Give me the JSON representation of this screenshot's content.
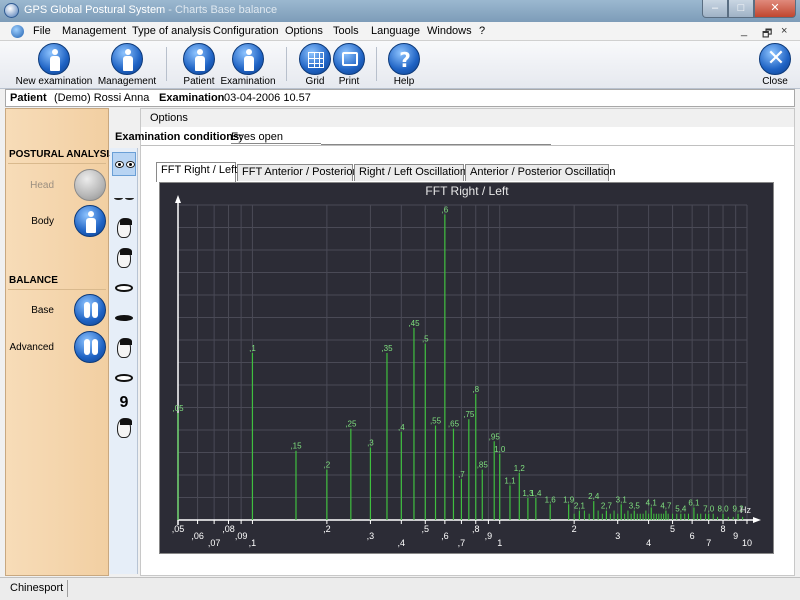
{
  "window": {
    "title": "GPS Global Postural System",
    "subtitle": " - Charts Base balance",
    "minimize_label": "–",
    "maximize_label": "□",
    "close_label": "✕"
  },
  "menu": {
    "items": [
      "File",
      "Management",
      "Type of analysis",
      "Configuration",
      "Options",
      "Tools",
      "Language",
      "Windows",
      "?"
    ],
    "mdi_minimize": "_",
    "mdi_restore": "🗗",
    "mdi_close": "×"
  },
  "toolbar": {
    "new_examination": "New examination",
    "management": "Management",
    "patient": "Patient",
    "examination": "Examination",
    "grid": "Grid",
    "print": "Print",
    "help": "Help",
    "close": "Close"
  },
  "infobar": {
    "patient_label": "Patient",
    "patient_value": "(Demo) Rossi Anna",
    "exam_label": "Examination",
    "exam_value": "03-04-2006 10.57"
  },
  "leftpanel": {
    "postural_title": "POSTURAL ANALYSIS",
    "head": "Head",
    "body": "Body",
    "balance_title": "BALANCE",
    "base": "Base",
    "advanced": "Advanced"
  },
  "iconstrip": {
    "icons": [
      "eyes-open-icon",
      "eyes-closed-icon",
      "head-turned-icon",
      "head-front-icon",
      "mouth-open-icon",
      "teeth-clenched-icon",
      "head-profile-icon",
      "mouth-wide-icon",
      "number-nine-icon",
      "foam-pad-icon"
    ],
    "nine_text": "9"
  },
  "main": {
    "options_label": "Options",
    "conditions_label": "Examination conditions:",
    "conditions_value": "Eyes open",
    "tabs": [
      "FFT Right / Left",
      "FFT Anterior / Posterior",
      "Right / Left Oscillation",
      "Anterior / Posterior Oscillation"
    ],
    "active_tab": 0
  },
  "chart_data": {
    "type": "bar",
    "title": "FFT Right / Left",
    "xlabel": "Hz",
    "ylabel": "",
    "x_scale": "log",
    "xlim": [
      0.05,
      10
    ],
    "ylim": [
      0,
      1
    ],
    "background": "#2c2c36",
    "bar_color": "#3fbf3f",
    "label_color": "#7fe07f",
    "grid": true,
    "x_ticks": [
      {
        "v": 0.05,
        "t": ",05"
      },
      {
        "v": 0.06,
        "t": ",06"
      },
      {
        "v": 0.07,
        "t": ",07"
      },
      {
        "v": 0.08,
        "t": ",08"
      },
      {
        "v": 0.09,
        "t": ",09"
      },
      {
        "v": 0.1,
        "t": ",1"
      },
      {
        "v": 0.2,
        "t": ",2"
      },
      {
        "v": 0.3,
        "t": ",3"
      },
      {
        "v": 0.4,
        "t": ",4"
      },
      {
        "v": 0.5,
        "t": ",5"
      },
      {
        "v": 0.6,
        "t": ",6"
      },
      {
        "v": 0.7,
        "t": ",7"
      },
      {
        "v": 0.8,
        "t": ",8"
      },
      {
        "v": 0.9,
        "t": ",9"
      },
      {
        "v": 1,
        "t": "1"
      },
      {
        "v": 2,
        "t": "2"
      },
      {
        "v": 3,
        "t": "3"
      },
      {
        "v": 4,
        "t": "4"
      },
      {
        "v": 5,
        "t": "5"
      },
      {
        "v": 6,
        "t": "6"
      },
      {
        "v": 7,
        "t": "7"
      },
      {
        "v": 8,
        "t": "8"
      },
      {
        "v": 9,
        "t": "9"
      },
      {
        "v": 10,
        "t": "10"
      }
    ],
    "bars": [
      {
        "x": 0.05,
        "y": 0.34,
        "label": ",05"
      },
      {
        "x": 0.1,
        "y": 0.53,
        "label": ",1"
      },
      {
        "x": 0.15,
        "y": 0.22,
        "label": ",15"
      },
      {
        "x": 0.2,
        "y": 0.16,
        "label": ",2"
      },
      {
        "x": 0.25,
        "y": 0.29,
        "label": ",25"
      },
      {
        "x": 0.3,
        "y": 0.23,
        "label": ",3"
      },
      {
        "x": 0.35,
        "y": 0.53,
        "label": ",35"
      },
      {
        "x": 0.4,
        "y": 0.28,
        "label": ",4"
      },
      {
        "x": 0.45,
        "y": 0.61,
        "label": ",45"
      },
      {
        "x": 0.5,
        "y": 0.56,
        "label": ",5"
      },
      {
        "x": 0.55,
        "y": 0.3,
        "label": ",55"
      },
      {
        "x": 0.6,
        "y": 0.97,
        "label": ",6"
      },
      {
        "x": 0.65,
        "y": 0.29,
        "label": ",65"
      },
      {
        "x": 0.7,
        "y": 0.13,
        "label": ",7"
      },
      {
        "x": 0.75,
        "y": 0.32,
        "label": ",75"
      },
      {
        "x": 0.8,
        "y": 0.4,
        "label": ",8"
      },
      {
        "x": 0.85,
        "y": 0.16,
        "label": ",85"
      },
      {
        "x": 0.95,
        "y": 0.25,
        "label": ",95"
      },
      {
        "x": 1.0,
        "y": 0.21,
        "label": "1,0"
      },
      {
        "x": 1.1,
        "y": 0.11,
        "label": "1,1"
      },
      {
        "x": 1.2,
        "y": 0.15,
        "label": "1,2"
      },
      {
        "x": 1.3,
        "y": 0.07,
        "label": "1,3"
      },
      {
        "x": 1.4,
        "y": 0.07,
        "label": "1,4"
      },
      {
        "x": 1.6,
        "y": 0.05,
        "label": "1,6"
      },
      {
        "x": 1.9,
        "y": 0.05,
        "label": "1,9"
      },
      {
        "x": 2.1,
        "y": 0.03,
        "label": "2,1"
      },
      {
        "x": 2.4,
        "y": 0.06,
        "label": "2,4"
      },
      {
        "x": 2.7,
        "y": 0.03,
        "label": "2,7"
      },
      {
        "x": 3.1,
        "y": 0.05,
        "label": "3,1"
      },
      {
        "x": 3.5,
        "y": 0.03,
        "label": "3,5"
      },
      {
        "x": 4.1,
        "y": 0.04,
        "label": "4,1"
      },
      {
        "x": 4.7,
        "y": 0.03,
        "label": "4,7"
      },
      {
        "x": 5.4,
        "y": 0.02,
        "label": "5,4"
      },
      {
        "x": 6.1,
        "y": 0.04,
        "label": "6,1"
      },
      {
        "x": 7.0,
        "y": 0.02,
        "label": "7,0"
      },
      {
        "x": 8.0,
        "y": 0.02,
        "label": "8,0"
      },
      {
        "x": 9.2,
        "y": 0.02,
        "label": "9,2"
      }
    ],
    "small_bars": [
      {
        "x": 2.0,
        "y": 0.02
      },
      {
        "x": 2.2,
        "y": 0.03
      },
      {
        "x": 2.3,
        "y": 0.02
      },
      {
        "x": 2.5,
        "y": 0.03
      },
      {
        "x": 2.6,
        "y": 0.02
      },
      {
        "x": 2.8,
        "y": 0.02
      },
      {
        "x": 2.9,
        "y": 0.03
      },
      {
        "x": 3.0,
        "y": 0.02
      },
      {
        "x": 3.2,
        "y": 0.02
      },
      {
        "x": 3.3,
        "y": 0.03
      },
      {
        "x": 3.4,
        "y": 0.02
      },
      {
        "x": 3.6,
        "y": 0.02
      },
      {
        "x": 3.7,
        "y": 0.02
      },
      {
        "x": 3.8,
        "y": 0.02
      },
      {
        "x": 3.9,
        "y": 0.03
      },
      {
        "x": 4.0,
        "y": 0.02
      },
      {
        "x": 4.2,
        "y": 0.02
      },
      {
        "x": 4.3,
        "y": 0.02
      },
      {
        "x": 4.4,
        "y": 0.02
      },
      {
        "x": 4.5,
        "y": 0.02
      },
      {
        "x": 4.6,
        "y": 0.02
      },
      {
        "x": 4.8,
        "y": 0.02
      },
      {
        "x": 5.0,
        "y": 0.02
      },
      {
        "x": 5.2,
        "y": 0.02
      },
      {
        "x": 5.6,
        "y": 0.02
      },
      {
        "x": 5.8,
        "y": 0.02
      },
      {
        "x": 6.3,
        "y": 0.02
      },
      {
        "x": 6.5,
        "y": 0.02
      },
      {
        "x": 6.8,
        "y": 0.02
      },
      {
        "x": 7.3,
        "y": 0.02
      },
      {
        "x": 7.6,
        "y": 0.01
      },
      {
        "x": 8.4,
        "y": 0.01
      },
      {
        "x": 8.8,
        "y": 0.01
      },
      {
        "x": 9.6,
        "y": 0.01
      }
    ]
  },
  "status": {
    "left": "Chinesport"
  }
}
